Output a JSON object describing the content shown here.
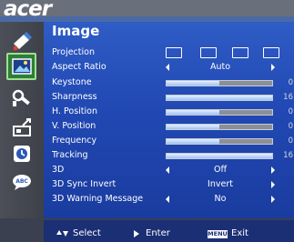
{
  "brand": {
    "logo_text": "acer"
  },
  "panel": {
    "title": "Image"
  },
  "sidebar": {
    "items": [
      {
        "name": "color-icon"
      },
      {
        "name": "image-icon",
        "active": true
      },
      {
        "name": "settings-icon"
      },
      {
        "name": "management-icon"
      },
      {
        "name": "timer-icon"
      },
      {
        "name": "language-icon"
      }
    ]
  },
  "rows": {
    "projection": {
      "label": "Projection"
    },
    "aspect_ratio": {
      "label": "Aspect Ratio",
      "value": "Auto"
    },
    "keystone": {
      "label": "Keystone",
      "level": 0.5,
      "number": "0"
    },
    "sharpness": {
      "label": "Sharpness",
      "level": 1.0,
      "number": "16"
    },
    "h_position": {
      "label": "H. Position",
      "level": 0.5,
      "number": "0"
    },
    "v_position": {
      "label": "V. Position",
      "level": 0.5,
      "number": "0"
    },
    "frequency": {
      "label": "Frequency",
      "level": 0.5,
      "number": "0"
    },
    "tracking": {
      "label": "Tracking",
      "level": 1.0,
      "number": "16"
    },
    "three_d": {
      "label": "3D",
      "value": "Off"
    },
    "sync_invert": {
      "label": "3D Sync Invert",
      "value": "Invert"
    },
    "warning_message": {
      "label": "3D Warning Message",
      "value": "No"
    }
  },
  "footer": {
    "select_label": "Select",
    "enter_label": "Enter",
    "menu_key": "MENU",
    "exit_label": "Exit"
  },
  "colors": {
    "panel_blue": "#2148b3",
    "slider_fill": "#9cc3f4",
    "active_green": "#2f7d3a"
  }
}
